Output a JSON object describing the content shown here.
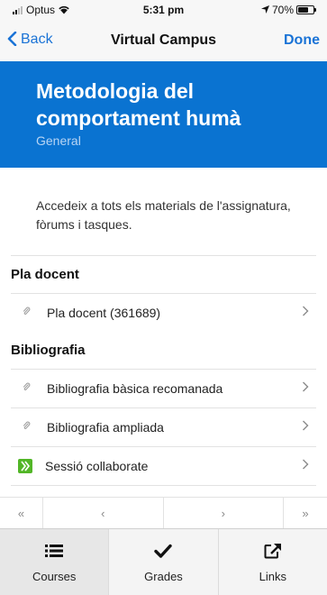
{
  "status_bar": {
    "carrier": "Optus",
    "time": "5:31 pm",
    "battery_percent": "70%",
    "battery_level": 0.7
  },
  "navbar": {
    "back_label": "Back",
    "title": "Virtual Campus",
    "done_label": "Done"
  },
  "hero": {
    "title": "Metodologia del comportament humà",
    "subtitle": "General",
    "color": "#0a73d1"
  },
  "description": "Accedeix a tots els materials de l'assignatura, fòrums i tasques.",
  "sections": [
    {
      "title": "Pla docent",
      "items": [
        {
          "label": "Pla docent (361689)",
          "icon": "paperclip-icon"
        }
      ]
    },
    {
      "title": "Bibliografia",
      "items": [
        {
          "label": "Bibliografia bàsica recomanada",
          "icon": "paperclip-icon"
        },
        {
          "label": "Bibliografia ampliada",
          "icon": "paperclip-icon"
        },
        {
          "label": "Sessió collaborate",
          "icon": "collaborate-icon"
        }
      ]
    }
  ],
  "pager": {
    "first": "«",
    "prev": "‹",
    "next": "›",
    "last": "»"
  },
  "tabs": [
    {
      "label": "Courses",
      "icon": "list-icon",
      "active": true
    },
    {
      "label": "Grades",
      "icon": "checkmark-icon",
      "active": false
    },
    {
      "label": "Links",
      "icon": "external-link-icon",
      "active": false
    }
  ]
}
